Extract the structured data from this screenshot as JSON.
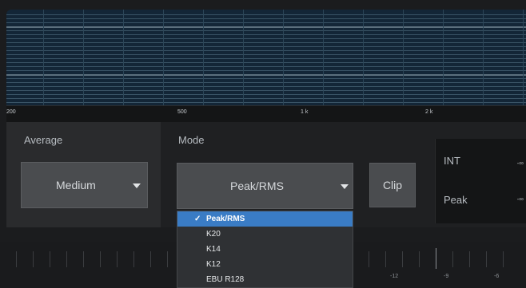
{
  "frequency_axis": {
    "ticks": [
      "200",
      "500",
      "1 k",
      "2 k"
    ]
  },
  "average": {
    "label": "Average",
    "value": "Medium"
  },
  "mode": {
    "label": "Mode",
    "value": "Peak/RMS",
    "options": [
      "Peak/RMS",
      "K20",
      "K14",
      "K12",
      "EBU R128"
    ],
    "selected_index": 0
  },
  "clip": {
    "label": "Clip"
  },
  "readouts": {
    "int_label": "INT",
    "int_value": "-∞",
    "peak_label": "Peak",
    "peak_value": "-∞"
  },
  "level_ruler": {
    "labels": [
      "-12",
      "-9",
      "-6"
    ]
  },
  "colors": {
    "selection": "#3a7cc5",
    "analyzer_bg": "#132637"
  },
  "icons": {
    "select_caret": "caret-down-icon",
    "selected_item": "check-icon"
  }
}
